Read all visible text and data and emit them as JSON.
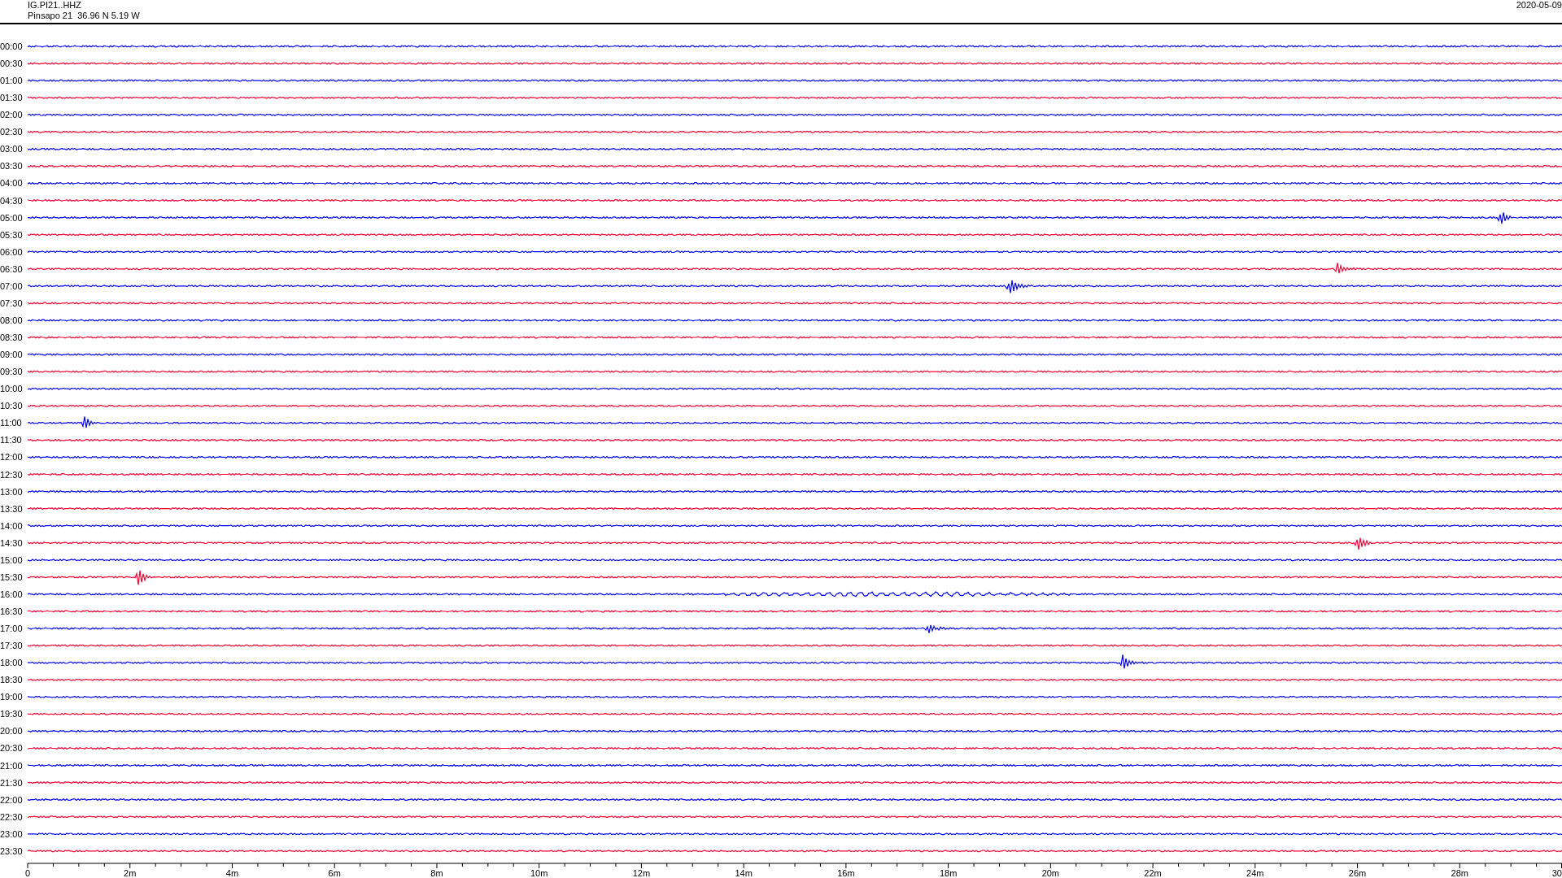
{
  "header": {
    "channel": "IG.PI21..HHZ",
    "station": "Pinsapo 21  36.96 N 5.19 W",
    "date": "2020-05-09"
  },
  "traces": [
    {
      "label": "00:00",
      "color": "#0000ff"
    },
    {
      "label": "00:30",
      "color": "#ff0033"
    },
    {
      "label": "01:00",
      "color": "#0000ff"
    },
    {
      "label": "01:30",
      "color": "#ff0033"
    },
    {
      "label": "02:00",
      "color": "#0000ff"
    },
    {
      "label": "02:30",
      "color": "#ff0033"
    },
    {
      "label": "03:00",
      "color": "#0000ff"
    },
    {
      "label": "03:30",
      "color": "#ff0033"
    },
    {
      "label": "04:00",
      "color": "#0000ff"
    },
    {
      "label": "04:30",
      "color": "#ff0033"
    },
    {
      "label": "05:00",
      "color": "#0000ff"
    },
    {
      "label": "05:30",
      "color": "#ff0033"
    },
    {
      "label": "06:00",
      "color": "#0000ff"
    },
    {
      "label": "06:30",
      "color": "#ff0033"
    },
    {
      "label": "07:00",
      "color": "#0000ff"
    },
    {
      "label": "07:30",
      "color": "#ff0033"
    },
    {
      "label": "08:00",
      "color": "#0000ff"
    },
    {
      "label": "08:30",
      "color": "#ff0033"
    },
    {
      "label": "09:00",
      "color": "#0000ff"
    },
    {
      "label": "09:30",
      "color": "#ff0033"
    },
    {
      "label": "10:00",
      "color": "#0000ff"
    },
    {
      "label": "10:30",
      "color": "#ff0033"
    },
    {
      "label": "11:00",
      "color": "#0000ff"
    },
    {
      "label": "11:30",
      "color": "#ff0033"
    },
    {
      "label": "12:00",
      "color": "#0000ff"
    },
    {
      "label": "12:30",
      "color": "#ff0033"
    },
    {
      "label": "13:00",
      "color": "#0000ff"
    },
    {
      "label": "13:30",
      "color": "#ff0033"
    },
    {
      "label": "14:00",
      "color": "#0000ff"
    },
    {
      "label": "14:30",
      "color": "#ff0033"
    },
    {
      "label": "15:00",
      "color": "#0000ff"
    },
    {
      "label": "15:30",
      "color": "#ff0033"
    },
    {
      "label": "16:00",
      "color": "#0000ff"
    },
    {
      "label": "16:30",
      "color": "#ff0033"
    },
    {
      "label": "17:00",
      "color": "#0000ff"
    },
    {
      "label": "17:30",
      "color": "#ff0033"
    },
    {
      "label": "18:00",
      "color": "#0000ff"
    },
    {
      "label": "18:30",
      "color": "#ff0033"
    },
    {
      "label": "19:00",
      "color": "#0000ff"
    },
    {
      "label": "19:30",
      "color": "#ff0033"
    },
    {
      "label": "20:00",
      "color": "#0000ff"
    },
    {
      "label": "20:30",
      "color": "#ff0033"
    },
    {
      "label": "21:00",
      "color": "#0000ff"
    },
    {
      "label": "21:30",
      "color": "#ff0033"
    },
    {
      "label": "22:00",
      "color": "#0000ff"
    },
    {
      "label": "22:30",
      "color": "#ff0033"
    },
    {
      "label": "23:00",
      "color": "#0000ff"
    },
    {
      "label": "23:30",
      "color": "#ff0033"
    }
  ],
  "x_axis": {
    "labels": [
      "0",
      "2m",
      "4m",
      "6m",
      "8m",
      "10m",
      "12m",
      "14m",
      "16m",
      "18m",
      "20m",
      "22m",
      "24m",
      "26m",
      "28m",
      "30"
    ]
  }
}
